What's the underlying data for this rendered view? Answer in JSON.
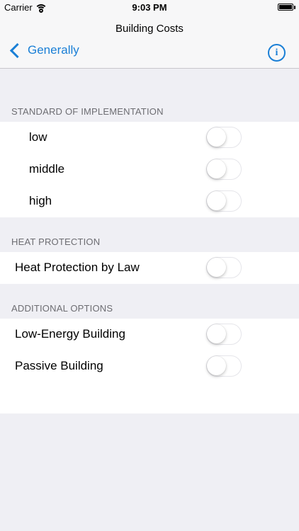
{
  "status_bar": {
    "carrier": "Carrier",
    "time": "9:03 PM",
    "battery_level": 1.0
  },
  "nav": {
    "title": "Building Costs",
    "back_label": "Generally",
    "info_glyph": "i",
    "accent_color": "#1a7fd6"
  },
  "sections": [
    {
      "header": "STANDARD OF IMPLEMENTATION",
      "rows": [
        {
          "label": "low",
          "on": false
        },
        {
          "label": "middle",
          "on": false
        },
        {
          "label": "high",
          "on": false
        }
      ]
    },
    {
      "header": "HEAT PROTECTION",
      "rows": [
        {
          "label": "Heat Protection by Law",
          "on": false
        }
      ]
    },
    {
      "header": "ADDITIONAL OPTIONS",
      "rows": [
        {
          "label": "Low-Energy Building",
          "on": false
        },
        {
          "label": "Passive Building",
          "on": false
        }
      ]
    }
  ]
}
